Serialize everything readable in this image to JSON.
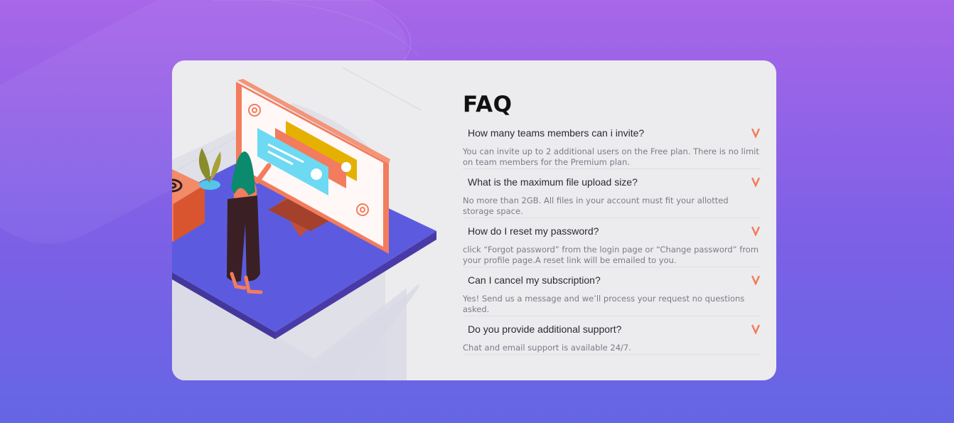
{
  "faq": {
    "title": "FAQ",
    "items": [
      {
        "question": "How many teams members can i invite?",
        "answer": "You can invite up to 2 additional users on the Free plan. There is no limit on team members for the Premium plan."
      },
      {
        "question": "What is the maximum file upload size?",
        "answer": "No more than 2GB. All files in your account must fit your allotted storage space."
      },
      {
        "question": "How do I reset my password?",
        "answer": "click “Forgot password” from the login page or “Change password” from your profile page.A reset link will be emailed to you."
      },
      {
        "question": "Can I cancel my subscription?",
        "answer": "Yes! Send us a message and we’ll process your request no questions asked."
      },
      {
        "question": "Do you provide additional support?",
        "answer": "Chat and email support is available 24/7."
      }
    ]
  },
  "icons": {
    "chevron": "chevron-down-icon"
  },
  "colors": {
    "background_top": "#a866e8",
    "background_bottom": "#6566e4",
    "card": "#ececef",
    "accent": "#f27c5d",
    "platform": "#5c5be0"
  }
}
